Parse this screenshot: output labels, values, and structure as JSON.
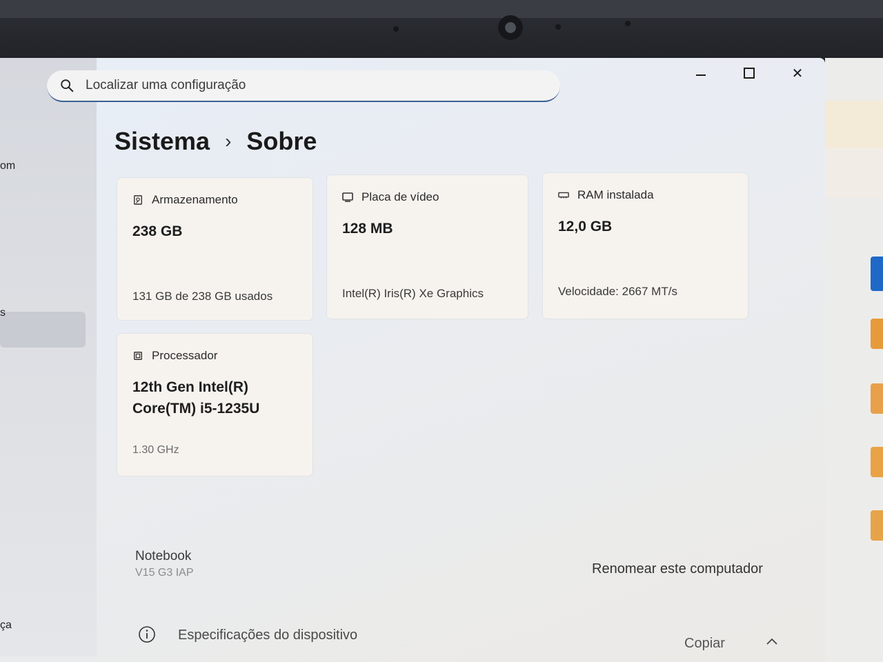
{
  "sidebar": {
    "fragments": [
      "om",
      "s",
      "ça"
    ]
  },
  "window_controls": {
    "minimize": "minimize",
    "maximize": "maximize",
    "close": "✕"
  },
  "search": {
    "placeholder": "Localizar uma configuração"
  },
  "breadcrumb": {
    "parent": "Sistema",
    "separator": "›",
    "current": "Sobre"
  },
  "cards": {
    "storage": {
      "label": "Armazenamento",
      "value": "238 GB",
      "detail": "131 GB de 238 GB usados",
      "icon": "storage-icon"
    },
    "video": {
      "label": "Placa de vídeo",
      "value": "128 MB",
      "detail": "Intel(R) Iris(R) Xe Graphics",
      "icon": "display-adapter-icon"
    },
    "ram": {
      "label": "RAM instalada",
      "value": "12,0 GB",
      "detail": "Velocidade: 2667 MT/s",
      "icon": "ram-icon"
    },
    "cpu": {
      "label": "Processador",
      "value": "12th Gen Intel(R) Core(TM) i5-1235U",
      "detail": "1.30 GHz",
      "icon": "processor-icon"
    }
  },
  "device": {
    "name": "Notebook",
    "model": "V15 G3 IAP",
    "rename_label": "Renomear este computador"
  },
  "specs": {
    "title": "Especificações do dispositivo",
    "copy_label": "Copiar",
    "icon": "info-icon"
  },
  "colors": {
    "accent": "#3d5f93",
    "card_bg": "#f6f3ee",
    "bezel": "#202227"
  }
}
